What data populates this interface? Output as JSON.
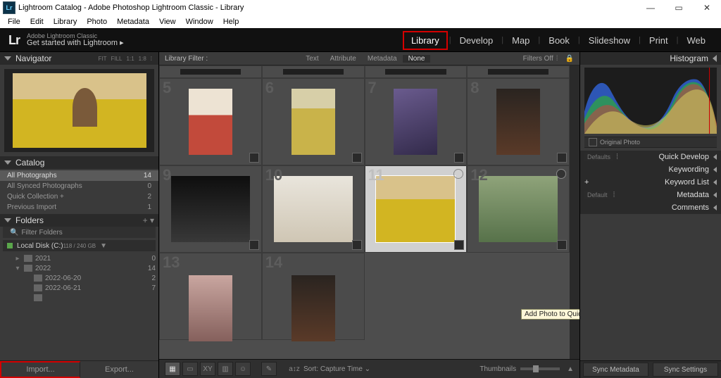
{
  "window": {
    "title": "Lightroom Catalog - Adobe Photoshop Lightroom Classic - Library",
    "menu": [
      "File",
      "Edit",
      "Library",
      "Photo",
      "Metadata",
      "View",
      "Window",
      "Help"
    ]
  },
  "header": {
    "logo_prefix": "L",
    "logo_suffix": "r",
    "tag_small": "Adobe Lightroom Classic",
    "tag_main": "Get started with Lightroom ▸",
    "modules": [
      "Library",
      "Develop",
      "Map",
      "Book",
      "Slideshow",
      "Print",
      "Web"
    ],
    "active_module": "Library"
  },
  "left": {
    "navigator": {
      "title": "Navigator",
      "opts": [
        "FIT",
        "FILL",
        "1:1",
        "1:8"
      ]
    },
    "catalog": {
      "title": "Catalog",
      "items": [
        {
          "label": "All Photographs",
          "count": "14",
          "sel": true
        },
        {
          "label": "All Synced Photographs",
          "count": "0"
        },
        {
          "label": "Quick Collection  +",
          "count": "2"
        },
        {
          "label": "Previous Import",
          "count": "1"
        }
      ]
    },
    "folders": {
      "title": "Folders",
      "filter_placeholder": "Filter Folders",
      "disk": {
        "name": "Local Disk (C:)",
        "stats": "118 / 240 GB"
      },
      "tree": [
        {
          "tw": "▸",
          "ind": 1,
          "label": "2021",
          "count": "0"
        },
        {
          "tw": "▾",
          "ind": 1,
          "label": "2022",
          "count": "14"
        },
        {
          "tw": "",
          "ind": 2,
          "label": "2022-06-20",
          "count": "2"
        },
        {
          "tw": "",
          "ind": 2,
          "label": "2022-06-21",
          "count": "7"
        },
        {
          "tw": "",
          "ind": 2,
          "label": " ",
          "count": " "
        }
      ]
    },
    "import_label": "Import...",
    "export_label": "Export..."
  },
  "center": {
    "filter": {
      "label": "Library Filter :",
      "tabs": [
        "Text",
        "Attribute",
        "Metadata",
        "None"
      ],
      "active": "None",
      "state": "Filters Off"
    },
    "grid": {
      "rows": [
        {
          "fragment": true,
          "cells": [
            {
              "kind": "strip"
            },
            {
              "kind": "strip"
            },
            {
              "kind": "strip"
            },
            {
              "kind": "strip"
            }
          ]
        },
        {
          "cells": [
            {
              "num": "5",
              "thumb": "portrait t-red"
            },
            {
              "num": "6",
              "thumb": "portrait t-yel"
            },
            {
              "num": "7",
              "thumb": "portrait t-pur"
            },
            {
              "num": "8",
              "thumb": "portrait t-drk"
            }
          ]
        },
        {
          "cells": [
            {
              "num": "9",
              "thumb": "land t-blk"
            },
            {
              "num": "10",
              "thumb": "land t-wht"
            },
            {
              "num": "11",
              "thumb": "land t-sun",
              "sel": true
            },
            {
              "num": "12",
              "thumb": "land t-grn"
            }
          ]
        },
        {
          "cells": [
            {
              "num": "13",
              "thumb": "portrait t-pnk"
            },
            {
              "num": "14",
              "thumb": "portrait t-drk"
            },
            {
              "empty": true
            },
            {
              "empty": true
            }
          ]
        }
      ],
      "tooltip": "Add Photo to Quick Collection"
    },
    "toolbar": {
      "sort_label": "Sort:",
      "sort_value": "Capture Time",
      "thumbs_label": "Thumbnails"
    }
  },
  "right": {
    "histogram_title": "Histogram",
    "original_label": "Original Photo",
    "sections": [
      {
        "prefix": "Defaults",
        "label": "Quick Develop"
      },
      {
        "prefix": "",
        "label": "Keywording"
      },
      {
        "prefix": "+",
        "label": "Keyword List"
      },
      {
        "prefix": "Default",
        "label": "Metadata"
      },
      {
        "prefix": "",
        "label": "Comments"
      }
    ],
    "sync_meta": "Sync Metadata",
    "sync_set": "Sync Settings"
  }
}
